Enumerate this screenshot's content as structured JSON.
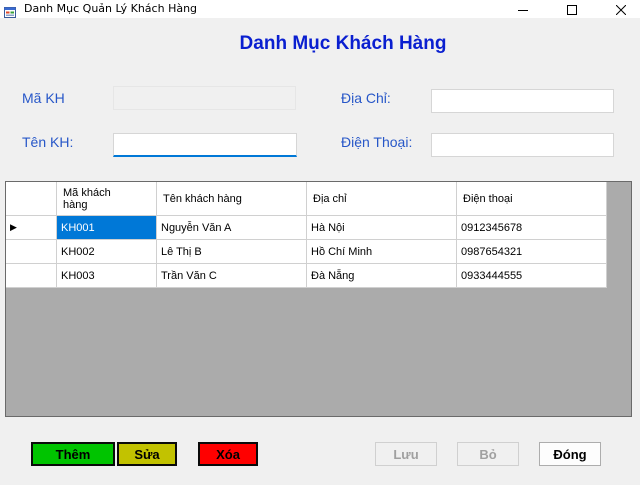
{
  "window": {
    "title": "Danh Mục Quản Lý Khách Hàng"
  },
  "form": {
    "heading": "Danh Mục Khách Hàng",
    "labels": {
      "ma_kh": "Mã KH",
      "ten_kh": "Tên KH:",
      "dia_chi": "Địa Chỉ:",
      "dien_thoai": "Điện Thoại:"
    },
    "fields": {
      "ma_kh": "",
      "ten_kh": "",
      "dia_chi": "",
      "dien_thoai": ""
    }
  },
  "grid": {
    "columns": [
      "Mã khách\nhàng",
      "Tên khách hàng",
      "Địa chỉ",
      "Điện thoại"
    ],
    "rows": [
      {
        "ma": "KH001",
        "ten": "Nguyễn Văn A",
        "dia_chi": "Hà Nội",
        "dien_thoai": "0912345678"
      },
      {
        "ma": "KH002",
        "ten": "Lê Thị B",
        "dia_chi": "Hồ Chí Minh",
        "dien_thoai": "0987654321"
      },
      {
        "ma": "KH003",
        "ten": "Trần Văn C",
        "dia_chi": "Đà Nẵng",
        "dien_thoai": "0933444555"
      }
    ],
    "current_row_indicator": "▶"
  },
  "buttons": {
    "them": "Thêm",
    "sua": "Sửa",
    "xoa": "Xóa",
    "luu": "Lưu",
    "bo": "Bỏ",
    "dong": "Đóng"
  },
  "icons": {
    "app": "form-app-icon",
    "minimize": "minimize-icon",
    "maximize": "maximize-icon",
    "close": "close-icon"
  },
  "colors": {
    "heading": "#0a1fd0",
    "labels": "#2757c8",
    "them_button": "#00c400",
    "sua_button": "#c2c200",
    "xoa_button": "#ff0000",
    "selected_cell": "#0078d7",
    "grid_background": "#ababab"
  }
}
